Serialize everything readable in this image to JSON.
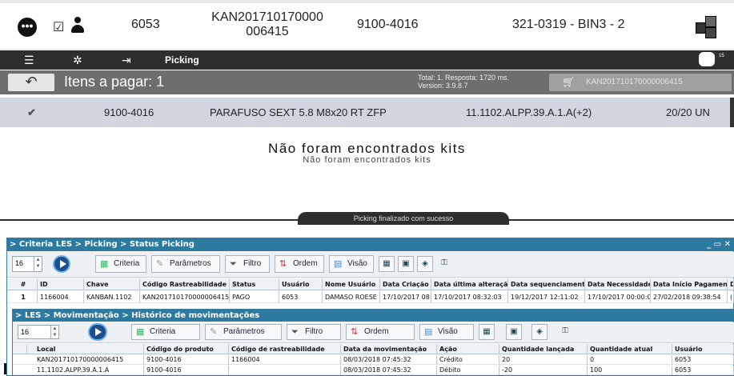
{
  "header": {
    "more_icon": "more-dots-icon",
    "check_icon": "checkbox-icon",
    "user_icon": "user-icon",
    "code": "6053",
    "tracking_line1": "KAN201710170000",
    "tracking_line2": "006415",
    "product": "9100-4016",
    "location": "321-0319 - BIN3 - 2",
    "boxes_icon": "boxes-icon"
  },
  "toolbar": {
    "menu_icon": "list-icon",
    "settings_icon": "gear-icon",
    "exit_icon": "exit-icon",
    "label": "Picking",
    "right_icon": "chat-icon",
    "right_badge": "15"
  },
  "actionbar": {
    "back_icon": "back-arrow-icon",
    "title": "Itens a pagar: 1",
    "total": "Total: 1. Resposta: 1720 ms.",
    "version": "Version: 3.9.8.7",
    "cart_icon": "cart-icon",
    "cart_label": "KAN201710170000006415"
  },
  "item": {
    "check": "✔",
    "product": "9100-4016",
    "description": "PARAFUSO SEXT 5.8  M8x20 RT ZFP",
    "location": "11.1102.ALPP.39.A.1.A(+2)",
    "qty": "20/20 UN"
  },
  "empty": {
    "title": "Não foram encontrados kits",
    "subtitle": "Não foram encontrados kits"
  },
  "toast": "Picking finalizado com sucesso",
  "win1": {
    "title": "> Criteria LES > Picking > Status Picking",
    "controls": "_ ▭ ✕",
    "page_size": "16",
    "buttons": {
      "criteria": "Criteria",
      "parametros": "Parâmetros",
      "filtro": "Filtro",
      "ordem": "Ordem",
      "visao": "Visão"
    },
    "columns": [
      "#",
      "ID",
      "Chave",
      "Código Rastreabilidade",
      "Status",
      "Usuário",
      "Nome Usuário",
      "Data Criação",
      "Data última alteração",
      "Data sequenciamento",
      "Data Necessidade",
      "Data Início Pagamento",
      "D"
    ],
    "row": [
      "1",
      "1166004",
      "KANBAN.1102",
      "KAN201710170000006415",
      "PAGO",
      "6053",
      "DAMASO ROESE D",
      "17/10/2017 08:3",
      "17/10/2017 08:32:03",
      "19/12/2017 12:11:02",
      "17/10/2017 00:00:00",
      "27/02/2018 09:38:54",
      "("
    ]
  },
  "win2": {
    "title": "> LES > Movimentação > Histórico de movimentações",
    "page_size": "16",
    "buttons": {
      "criteria": "Criteria",
      "parametros": "Parâmetros",
      "filtro": "Filtro",
      "ordem": "Ordem",
      "visao": "Visão"
    },
    "columns": [
      "Local",
      "Código do produto",
      "Código de rastreabilidade",
      "Data da movimentação",
      "Ação",
      "Quantidade lançada",
      "Quantidade atual",
      "Usuário"
    ],
    "rows": [
      [
        "KAN201710170000006415",
        "9100-4016",
        "1166004",
        "08/03/2018 07:45:32",
        "Crédito",
        "20",
        "0",
        "6053"
      ],
      [
        "11.1102.ALPP.39.A.1.A",
        "9100-4016",
        "",
        "08/03/2018 07:45:32",
        "Débito",
        "-20",
        "100",
        "6053"
      ]
    ]
  }
}
